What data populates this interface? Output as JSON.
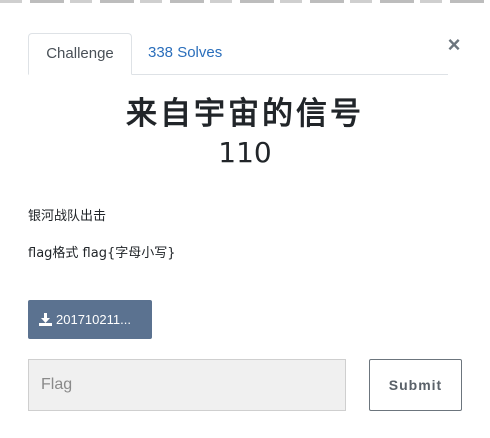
{
  "tabs": {
    "challenge": "Challenge",
    "solves": "338 Solves"
  },
  "close_label": "×",
  "challenge": {
    "name": "来自宇宙的信号",
    "points": "110",
    "description": [
      "银河战队出击",
      "flag格式 flag{字母小写}"
    ]
  },
  "file": {
    "label": "201710211...",
    "icon": "download-icon"
  },
  "flag_input": {
    "placeholder": "Flag",
    "value": ""
  },
  "submit_label": "Submit",
  "colors": {
    "link": "#2a6ebb",
    "file_button": "#5b7290",
    "input_bg": "#f0f0f0"
  }
}
